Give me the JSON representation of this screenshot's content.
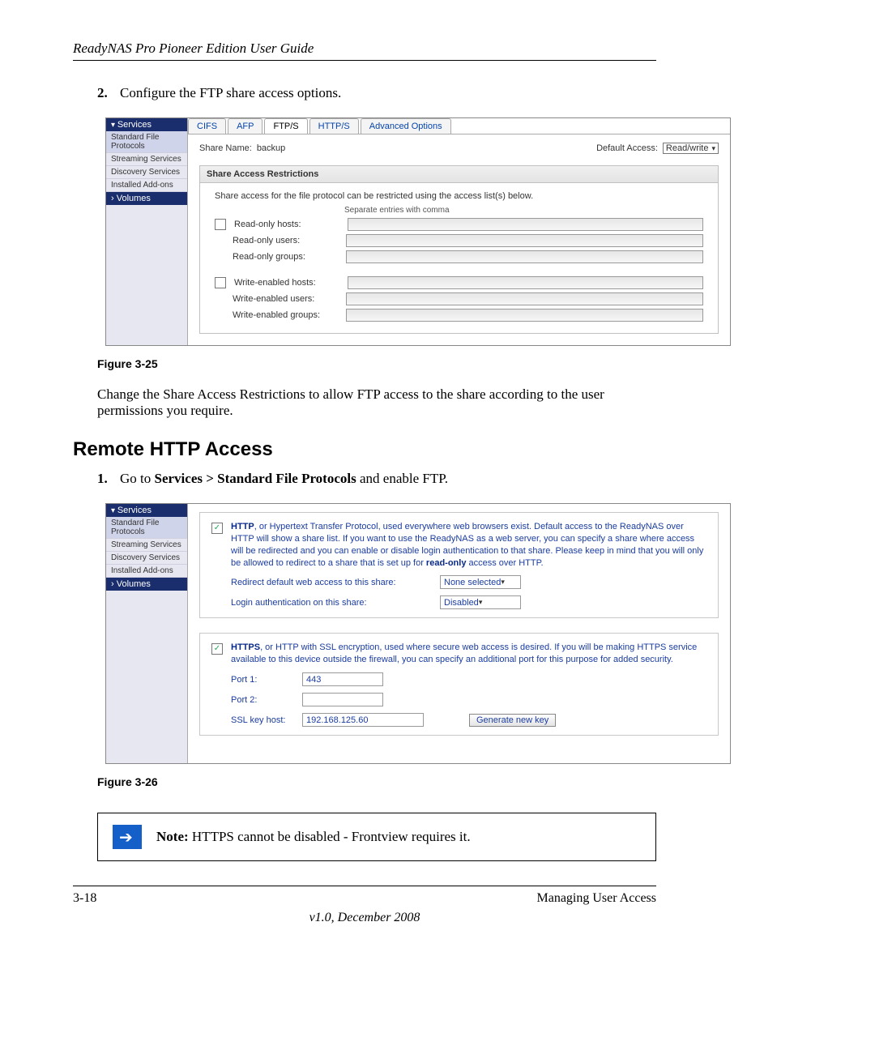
{
  "header": {
    "title": "ReadyNAS Pro Pioneer Edition User Guide"
  },
  "step2": {
    "num": "2.",
    "text": "Configure the FTP share access options."
  },
  "fig25": {
    "caption": "Figure 3-25",
    "sidebar": {
      "heading": "Services",
      "items": [
        "Standard File Protocols",
        "Streaming Services",
        "Discovery Services",
        "Installed Add-ons"
      ],
      "volumes": "Volumes"
    },
    "tabs": [
      "CIFS",
      "AFP",
      "FTP/S",
      "HTTP/S",
      "Advanced Options"
    ],
    "share_name_label": "Share Name:",
    "share_name_value": "backup",
    "default_access_label": "Default Access:",
    "default_access_value": "Read/write",
    "panel_title": "Share Access Restrictions",
    "panel_desc": "Share access for the file protocol can be restricted using the access list(s) below.",
    "hint": "Separate entries with comma",
    "ro_hosts": "Read-only hosts:",
    "ro_users": "Read-only users:",
    "ro_groups": "Read-only groups:",
    "we_hosts": "Write-enabled hosts:",
    "we_users": "Write-enabled users:",
    "we_groups": "Write-enabled groups:"
  },
  "para_after25": "Change the Share Access Restrictions to allow FTP access to the share according to the user permissions you require.",
  "section_heading": "Remote HTTP Access",
  "step1b": {
    "num": "1.",
    "prefix": "Go to ",
    "bold": "Services > Standard File Protocols",
    "suffix": " and enable FTP."
  },
  "fig26": {
    "caption": "Figure 3-26",
    "sidebar": {
      "heading": "Services",
      "items": [
        "Standard File Protocols",
        "Streaming Services",
        "Discovery Services",
        "Installed Add-ons"
      ],
      "volumes": "Volumes"
    },
    "http_bold": "HTTP",
    "http_text": ", or Hypertext Transfer Protocol, used everywhere web browsers exist. Default access to the ReadyNAS over HTTP will show a share list. If you want to use the ReadyNAS as a web server, you can specify a share where access will be redirected and you can enable or disable login authentication to that share. Please keep in mind that you will only be allowed to redirect to a share that is set up for ",
    "http_bold2": "read-only",
    "http_text2": " access over HTTP.",
    "redirect_label": "Redirect default web access to this share:",
    "redirect_value": "None selected",
    "login_label": "Login authentication on this share:",
    "login_value": "Disabled",
    "https_bold": "HTTPS",
    "https_text": ", or HTTP with SSL encryption, used where secure web access is desired. If you will be making HTTPS service available to this device outside the firewall, you can specify an additional port for this purpose for added security.",
    "port1_label": "Port 1:",
    "port1_value": "443",
    "port2_label": "Port 2:",
    "port2_value": "",
    "ssl_label": "SSL key host:",
    "ssl_value": "192.168.125.60",
    "gen_btn": "Generate new key"
  },
  "note": {
    "label": "Note:",
    "text": " HTTPS cannot be disabled - Frontview requires it."
  },
  "footer": {
    "page": "3-18",
    "section": "Managing User Access",
    "version": "v1.0, December 2008"
  }
}
